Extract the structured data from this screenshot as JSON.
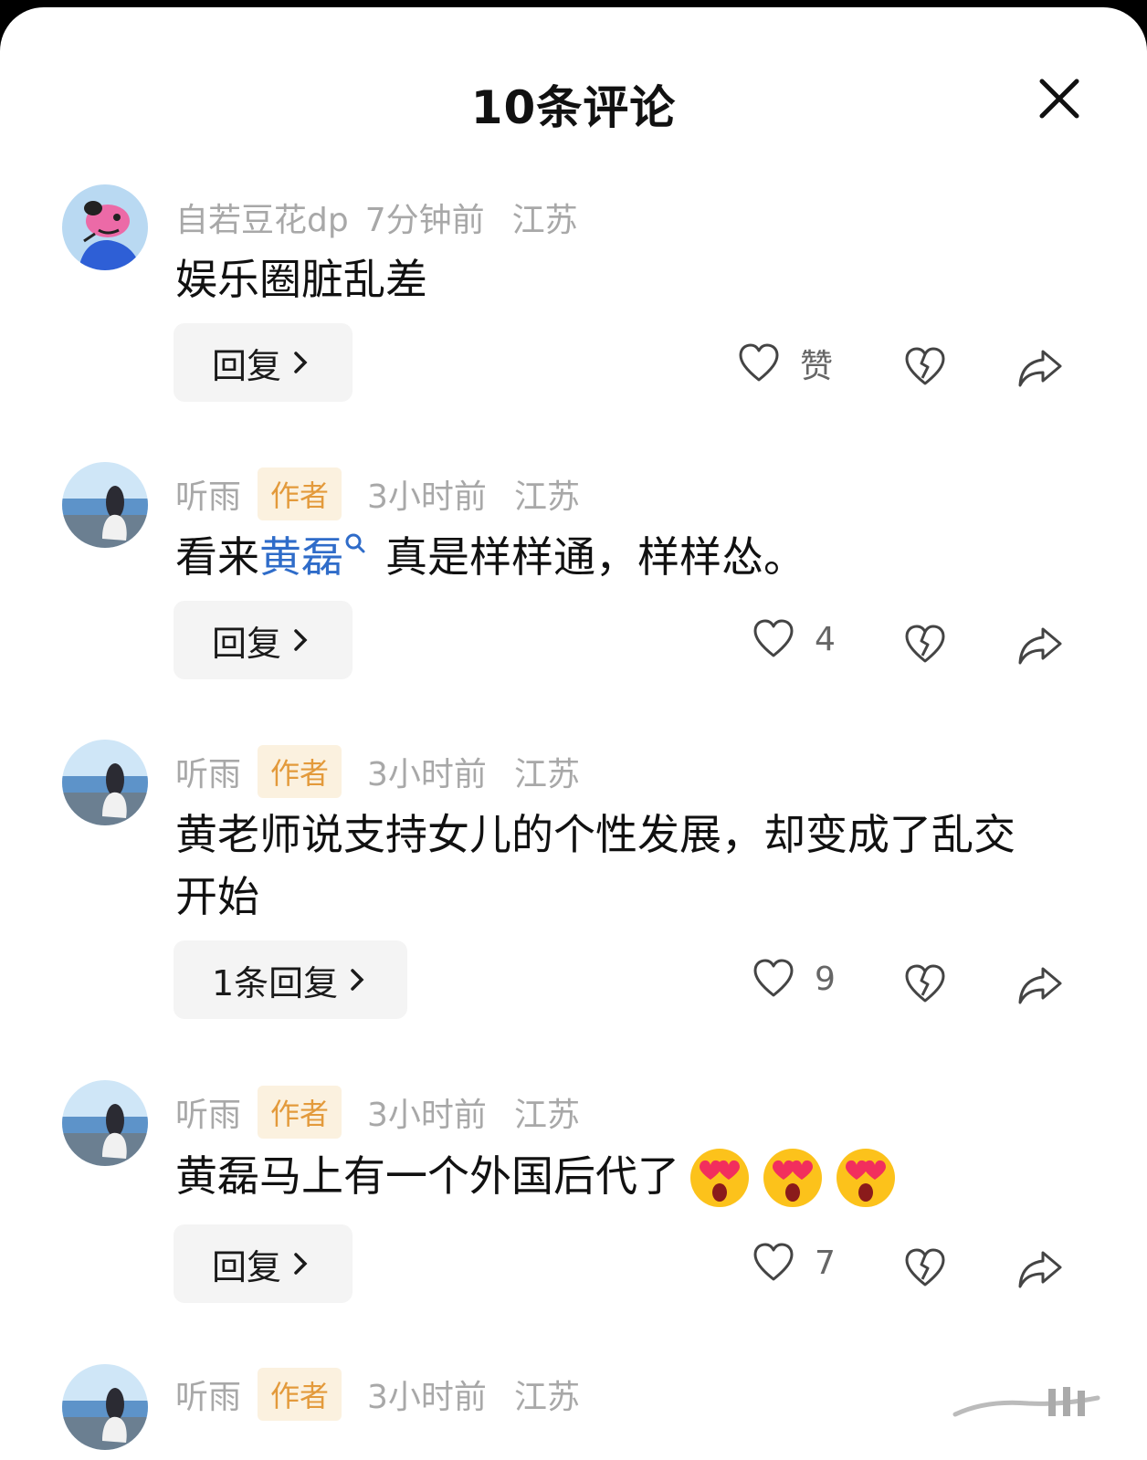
{
  "header": {
    "title": "10条评论"
  },
  "comments": [
    {
      "user": "自若豆花dp",
      "badge": "",
      "time": "7分钟前",
      "location": "江苏",
      "text_before": "娱乐圈脏乱差",
      "link": "",
      "text_after": "",
      "reply_label": "回复",
      "like_label": "赞"
    },
    {
      "user": "听雨",
      "badge": "作者",
      "time": "3小时前",
      "location": "江苏",
      "text_before": "看来",
      "link": "黄磊",
      "text_after": "真是样样通，样样怂。",
      "reply_label": "回复",
      "like_label": "4"
    },
    {
      "user": "听雨",
      "badge": "作者",
      "time": "3小时前",
      "location": "江苏",
      "text_before": "黄老师说支持女儿的个性发展，却变成了乱交开始",
      "link": "",
      "text_after": "",
      "reply_label": "1条回复",
      "like_label": "9"
    },
    {
      "user": "听雨",
      "badge": "作者",
      "time": "3小时前",
      "location": "江苏",
      "text_before": "黄磊马上有一个外国后代了",
      "link": "",
      "text_after": "",
      "emojis": [
        "heart-eyes-emoji",
        "heart-eyes-emoji",
        "heart-eyes-emoji"
      ],
      "reply_label": "回复",
      "like_label": "7"
    },
    {
      "user": "听雨",
      "badge": "作者",
      "time": "3小时前",
      "location": "江苏"
    }
  ],
  "icons": {
    "close": "close-icon",
    "like": "heart-outline-icon",
    "dislike": "broken-heart-icon",
    "share": "share-arrow-icon",
    "search": "search-icon",
    "chevron": "chevron-right-icon"
  },
  "colors": {
    "link": "#2f6cc9",
    "badge_bg": "#fbf1df",
    "badge_text": "#e39a3b",
    "meta": "#a8a8a8"
  }
}
